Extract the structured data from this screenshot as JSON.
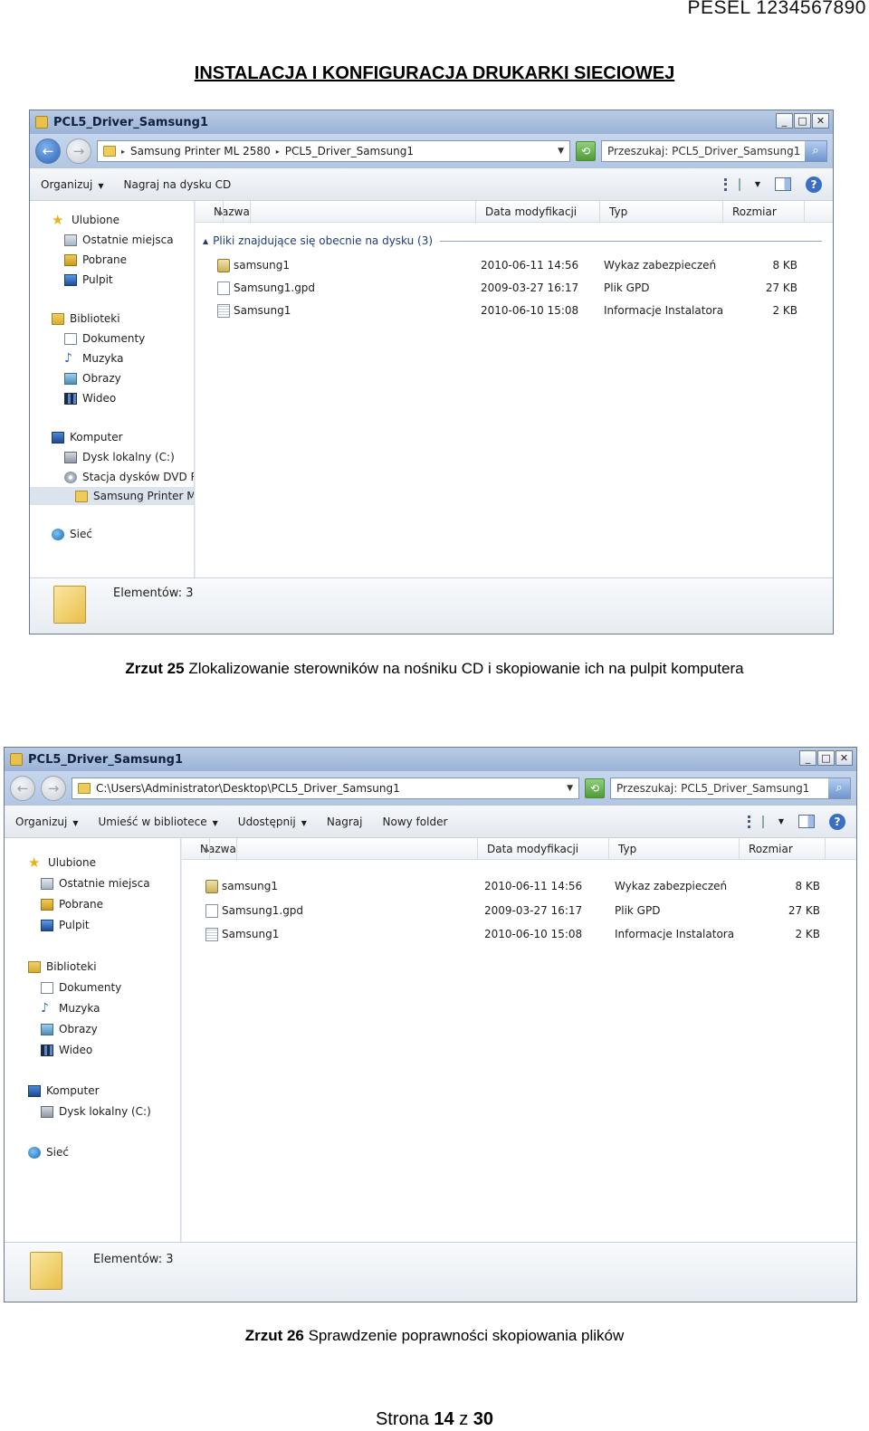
{
  "header": {
    "pesel": "PESEL  1234567890",
    "title": "INSTALACJA I KONFIGURACJA DRUKARKI SIECIOWEJ"
  },
  "figure1": {
    "window_title": "PCL5_Driver_Samsung1",
    "breadcrumb": [
      "Samsung Printer ML 2580",
      "PCL5_Driver_Samsung1"
    ],
    "search_placeholder": "Przeszukaj: PCL5_Driver_Samsung1",
    "toolbar": [
      "Organizuj",
      "Nagraj na dysku CD"
    ],
    "columns": [
      "Nazwa",
      "Data modyfikacji",
      "Typ",
      "Rozmiar"
    ],
    "group_label": "Pliki znajdujące się obecnie na dysku (3)",
    "nav": [
      "Ulubione",
      "Ostatnie miejsca",
      "Pobrane",
      "Pulpit",
      "Biblioteki",
      "Dokumenty",
      "Muzyka",
      "Obrazy",
      "Wideo",
      "Komputer",
      "Dysk lokalny (C:)",
      "Stacja dysków DVD RW",
      "Samsung Printer ML",
      "Sieć"
    ],
    "files": [
      {
        "name": "samsung1",
        "date": "2010-06-11 14:56",
        "type": "Wykaz zabezpieczeń",
        "size": "8 KB"
      },
      {
        "name": "Samsung1.gpd",
        "date": "2009-03-27 16:17",
        "type": "Plik GPD",
        "size": "27 KB"
      },
      {
        "name": "Samsung1",
        "date": "2010-06-10 15:08",
        "type": "Informacje Instalatora",
        "size": "2 KB"
      }
    ],
    "status": "Elementów: 3",
    "caption_label": "Zrzut 25",
    "caption_text": " Zlokalizowanie sterowników na nośniku CD i skopiowanie ich na pulpit komputera"
  },
  "figure2": {
    "window_title": "PCL5_Driver_Samsung1",
    "address": "C:\\Users\\Administrator\\Desktop\\PCL5_Driver_Samsung1",
    "search_placeholder": "Przeszukaj: PCL5_Driver_Samsung1",
    "toolbar": [
      "Organizuj",
      "Umieść w bibliotece",
      "Udostępnij",
      "Nagraj",
      "Nowy folder"
    ],
    "columns": [
      "Nazwa",
      "Data modyfikacji",
      "Typ",
      "Rozmiar"
    ],
    "nav": [
      "Ulubione",
      "Ostatnie miejsca",
      "Pobrane",
      "Pulpit",
      "Biblioteki",
      "Dokumenty",
      "Muzyka",
      "Obrazy",
      "Wideo",
      "Komputer",
      "Dysk lokalny (C:)",
      "Sieć"
    ],
    "files": [
      {
        "name": "samsung1",
        "date": "2010-06-11 14:56",
        "type": "Wykaz zabezpieczeń",
        "size": "8 KB"
      },
      {
        "name": "Samsung1.gpd",
        "date": "2009-03-27 16:17",
        "type": "Plik GPD",
        "size": "27 KB"
      },
      {
        "name": "Samsung1",
        "date": "2010-06-10 15:08",
        "type": "Informacje Instalatora",
        "size": "2 KB"
      }
    ],
    "status": "Elementów: 3",
    "caption_label": "Zrzut 26",
    "caption_text": " Sprawdzenie poprawności skopiowania plików"
  },
  "footer": {
    "prefix": "Strona ",
    "page": "14",
    "mid": " z ",
    "total": "30"
  }
}
